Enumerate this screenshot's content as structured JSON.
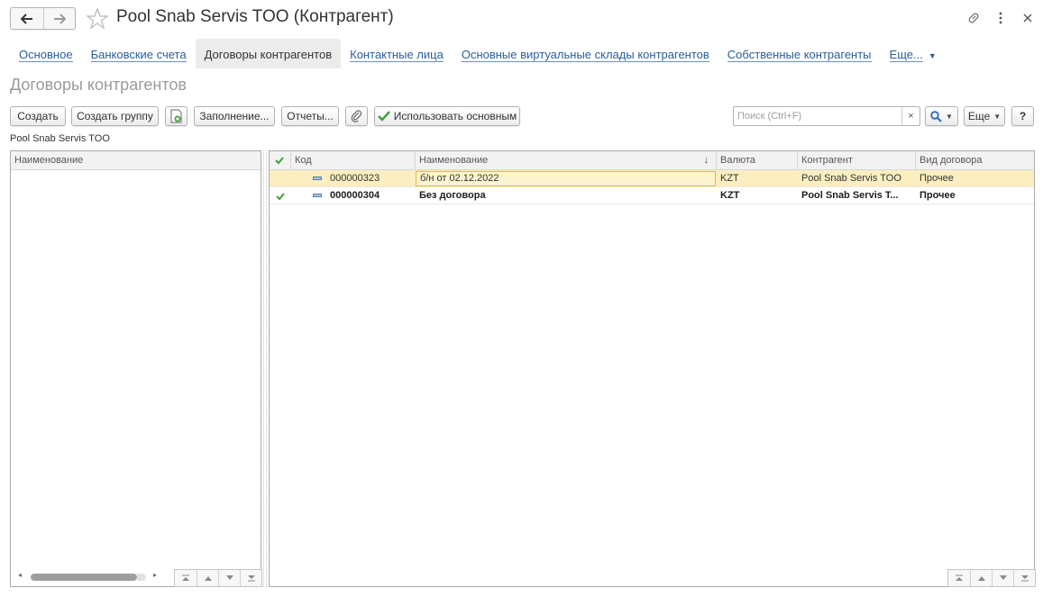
{
  "window": {
    "title": "Pool Snab Servis TOO (Контрагент)",
    "back_icon": "arrow-left-icon",
    "forward_icon": "arrow-right-icon",
    "favorite_icon": "star-icon",
    "link_icon": "link-icon",
    "menu_icon": "more-vertical-icon",
    "close_icon": "close-icon"
  },
  "tabs": [
    {
      "label": "Основное",
      "active": false
    },
    {
      "label": "Банковские счета",
      "active": false
    },
    {
      "label": "Договоры контрагентов",
      "active": true
    },
    {
      "label": "Контактные лица",
      "active": false
    },
    {
      "label": "Основные виртуальные склады контрагентов",
      "active": false
    },
    {
      "label": "Собственные контрагенты",
      "active": false
    },
    {
      "label": "Еще...",
      "active": false
    }
  ],
  "section_title": "Договоры контрагентов",
  "toolbar": {
    "create": "Создать",
    "create_group": "Создать группу",
    "copy_icon": "add-document-icon",
    "fill": "Заполнение...",
    "reports": "Отчеты...",
    "attach_icon": "paperclip-icon",
    "use_main": "Использовать основным",
    "use_main_icon": "checkmark-icon",
    "search_placeholder": "Поиск (Ctrl+F)",
    "search_value": "",
    "search_clear": "×",
    "search_icon": "search-icon",
    "more": "Еще",
    "help": "?"
  },
  "owner_label": "Pool Snab Servis TOO",
  "left_grid": {
    "header": "Наименование"
  },
  "right_grid": {
    "columns": [
      "Код",
      "Наименование",
      "Валюта",
      "Контрагент",
      "Вид договора"
    ],
    "sort_indicator": "↓",
    "rows": [
      {
        "main": false,
        "code": "000000323",
        "name": "б/н от 02.12.2022",
        "currency": "KZT",
        "counterparty": "Pool Snab Servis TOO",
        "type": "Прочее",
        "selected": true
      },
      {
        "main": true,
        "code": "000000304",
        "name": "Без договора",
        "currency": "KZT",
        "counterparty": "Pool Snab Servis T...",
        "type": "Прочее",
        "selected": false
      }
    ]
  },
  "colors": {
    "link": "#2c5e9e",
    "selected_row": "#fbeec0",
    "check_green": "#3aa23a",
    "focus_border": "#e7b846"
  }
}
